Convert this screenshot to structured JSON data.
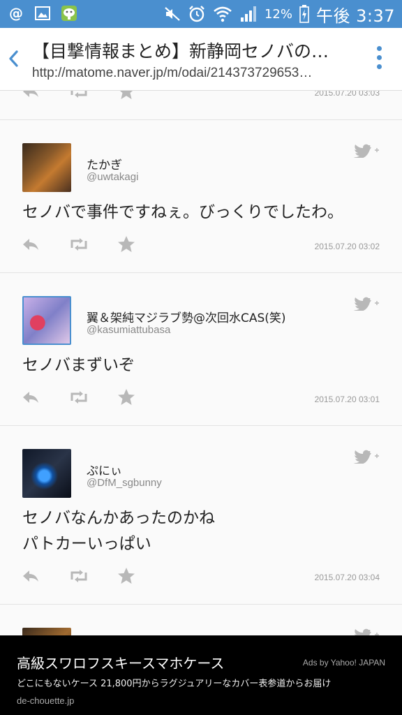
{
  "status_bar": {
    "battery": "12%",
    "time": "午後 3:37",
    "notification_icons": [
      "at-icon",
      "image-icon",
      "line-app-icon"
    ],
    "system_icons": [
      "mute-icon",
      "alarm-icon",
      "wifi-icon",
      "signal-icon",
      "battery-icon"
    ]
  },
  "browser": {
    "page_title": "【目撃情報まとめ】新静岡セノバの…",
    "url": "http://matome.naver.jp/m/odai/214373729653…"
  },
  "tweets": [
    {
      "name": "",
      "handle": "",
      "body_lines": [],
      "date": "2015.07.20 03:03"
    },
    {
      "name": "たかぎ",
      "handle": "@uwtakagi",
      "body_lines": [
        "セノバで事件ですねぇ。びっくりでしたわ。"
      ],
      "date": "2015.07.20 03:02"
    },
    {
      "name": "翼＆架純マジラブ勢@次回水CAS(笑)",
      "handle": "@kasumiattubasa",
      "body_lines": [
        "セノバまずいぞ"
      ],
      "date": "2015.07.20 03:01"
    },
    {
      "name": "ぷにぃ",
      "handle": "@DfM_sgbunny",
      "body_lines": [
        "セノバなんかあったのかね",
        "パトカーいっぱい"
      ],
      "date": "2015.07.20 03:04"
    }
  ],
  "ad": {
    "title": "高級スワロフスキースマホケース",
    "credit": "Ads by Yahoo! JAPAN",
    "description": "どこにもないケース 21,800円からラグジュアリーなカバー表参道からお届け",
    "url": "de-chouette.jp"
  },
  "colors": {
    "status_bar": "#4a8fcf",
    "accent": "#4a8fcf",
    "icon_gray": "#b8b8b8"
  }
}
